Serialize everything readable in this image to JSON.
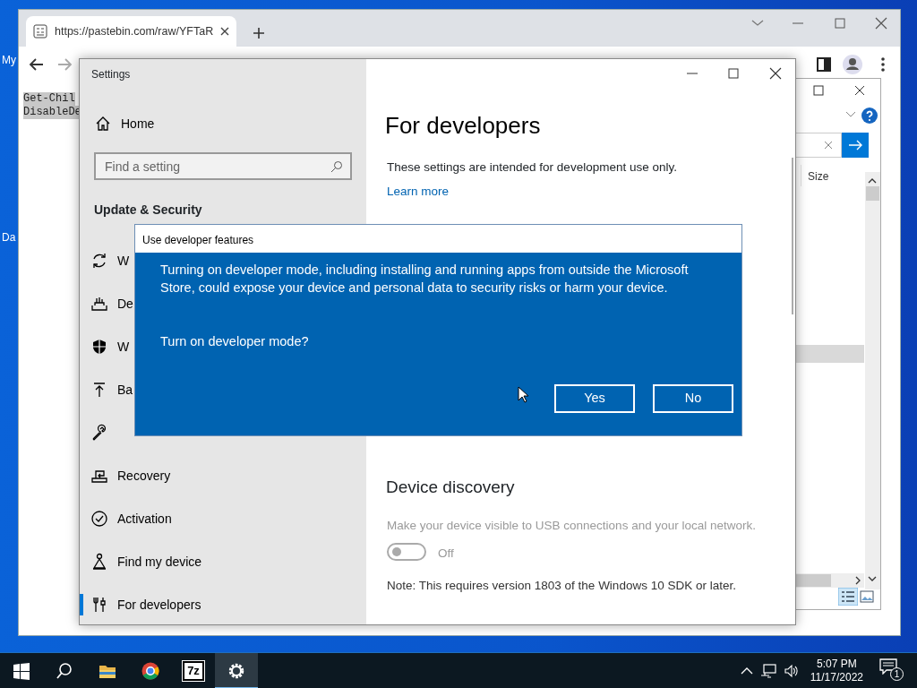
{
  "desktop": {
    "icon_labels": [
      "My",
      "Da"
    ]
  },
  "browser": {
    "tab": {
      "title": "https://pastebin.com/raw/YFTaR"
    },
    "content_lines": [
      "Get-Chil",
      "DisableDe"
    ]
  },
  "explorer": {
    "column_header": "Size"
  },
  "settings": {
    "title": "Settings",
    "home": "Home",
    "search": {
      "placeholder": "Find a setting"
    },
    "section": "Update & Security",
    "items": [
      {
        "label": "W",
        "kind": "refresh",
        "selected": false
      },
      {
        "label": "De",
        "kind": "tray",
        "selected": false
      },
      {
        "label": "W",
        "kind": "shield",
        "selected": false
      },
      {
        "label": "Ba",
        "kind": "up",
        "selected": false
      },
      {
        "kind": "wrench",
        "selected": false
      },
      {
        "label": "Recovery",
        "kind": "recovery",
        "selected": false
      },
      {
        "label": "Activation",
        "kind": "check",
        "selected": false
      },
      {
        "label": "Find my device",
        "kind": "person",
        "selected": false
      },
      {
        "label": "For developers",
        "kind": "tools",
        "selected": true
      }
    ],
    "page": {
      "title": "For developers",
      "intro": "These settings are intended for development use only.",
      "link": "Learn more",
      "sections": [
        {
          "title": "Device discovery",
          "description": "Make your device visible to USB connections and your local network.",
          "disabled": true,
          "toggle": {
            "on": false,
            "label": "Off"
          },
          "note": "Note: This requires version 1803 of the Windows 10 SDK or later."
        }
      ]
    }
  },
  "dialog": {
    "title": "Use developer features",
    "message": "Turning on developer mode, including installing and running apps from outside the Microsoft Store, could expose your device and personal data to security risks or harm your device.",
    "question": "Turn on developer mode?",
    "buttons": [
      "Yes",
      "No"
    ]
  },
  "taskbar": {
    "buttons": [
      {
        "kind": "start",
        "selected": false
      },
      {
        "kind": "search",
        "selected": false
      },
      {
        "kind": "folder",
        "selected": false
      },
      {
        "kind": "browser",
        "selected": false
      },
      {
        "kind": "archiver",
        "label": "7z",
        "selected": false
      },
      {
        "kind": "settings",
        "selected": true
      }
    ],
    "time": "5:07 PM",
    "date": "11/17/2022",
    "notification_count": "1"
  }
}
